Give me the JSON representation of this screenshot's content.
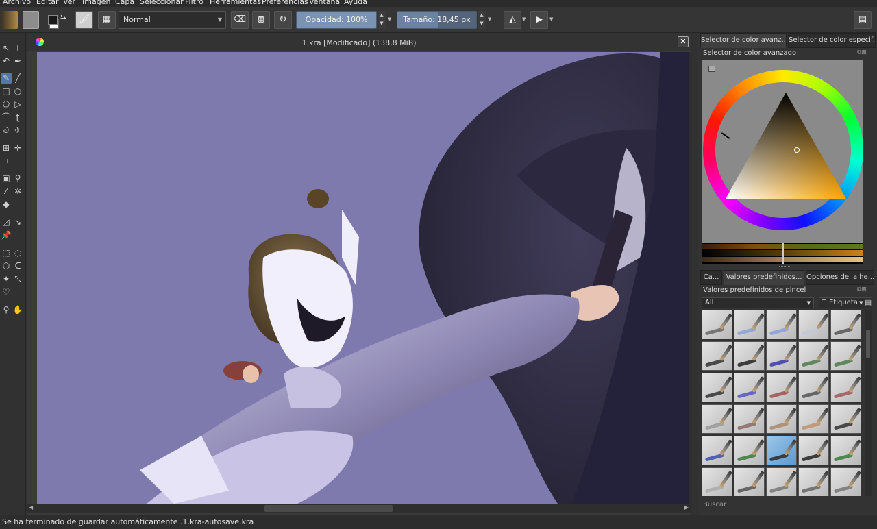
{
  "menu": [
    "Archivo",
    "Editar",
    "Ver",
    "Imagen",
    "Capa",
    "Seleccionar",
    "Filtro",
    "Herramientas",
    "Preferencias",
    "Ventana",
    "Ayuda"
  ],
  "toolbar": {
    "blend_mode": "Normal",
    "opacity_text": "Opacidad:  100%",
    "opacity_value": 1.0,
    "size_text": "Tamaño:  18,45 px",
    "size_value": 0.52
  },
  "colors": {
    "foreground": "#1a1a1a",
    "background": "#ffffff",
    "canvas_bg": "#7e7aae",
    "accent": "#5577a8"
  },
  "document": {
    "title": "1.kra [Modificado]  (138,8 MiB)"
  },
  "dock": {
    "tabs_top": [
      "Selector de color avanz...",
      "Selector de color especif..."
    ],
    "color_panel_title": "Selector de color avanzado",
    "tabs_bottom": [
      "Ca...",
      "Valores predefinidos...",
      "Opciones de la he..."
    ],
    "presets_title": "Valores predefinidos de pincel",
    "filter_value": "All",
    "tag_label": "Etiqueta",
    "search_placeholder": "Buscar"
  },
  "brush_presets": [
    {
      "color": "#666666"
    },
    {
      "color": "#8aa0d8"
    },
    {
      "color": "#8a9ed8"
    },
    {
      "color": "#bfc8d8"
    },
    {
      "color": "#555555"
    },
    {
      "color": "#333333"
    },
    {
      "color": "#222222"
    },
    {
      "color": "#3a3aa8"
    },
    {
      "color": "#4f7a4f"
    },
    {
      "color": "#4e7a4e"
    },
    {
      "color": "#333333"
    },
    {
      "color": "#5555c8"
    },
    {
      "color": "#a05050"
    },
    {
      "color": "#555555"
    },
    {
      "color": "#a05858"
    },
    {
      "color": "#999999"
    },
    {
      "color": "#8a6a6a"
    },
    {
      "color": "#a88a6a"
    },
    {
      "color": "#c09070"
    },
    {
      "color": "#333333"
    },
    {
      "color": "#3a4ea8"
    },
    {
      "color": "#3a7a3a"
    },
    {
      "color": "#2a2a2a"
    },
    {
      "color": "#222222"
    },
    {
      "color": "#3a7a3a"
    },
    {
      "color": "#aaaaaa"
    },
    {
      "color": "#555555"
    },
    {
      "color": "#777777"
    },
    {
      "color": "#666666"
    },
    {
      "color": "#777777"
    }
  ],
  "status": "Se ha terminado de guardar automáticamente .1.kra-autosave.kra"
}
